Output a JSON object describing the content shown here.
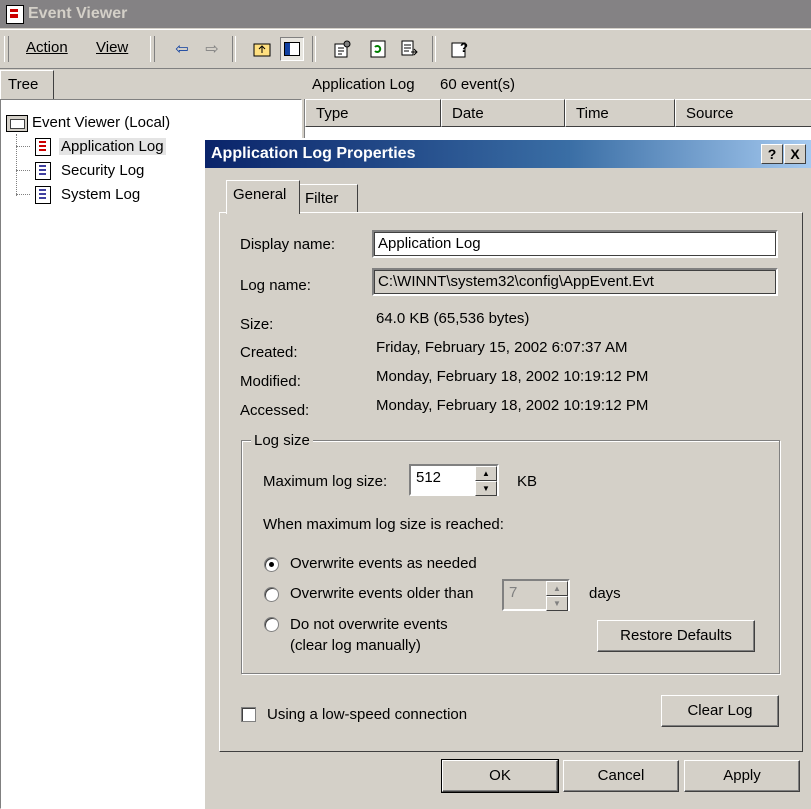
{
  "window": {
    "title": "Event Viewer"
  },
  "menu": {
    "action": "Action",
    "view": "View"
  },
  "toolbar_icons": [
    "back-arrow-icon",
    "forward-arrow-icon",
    "up-folder-icon",
    "show-hide-tree-icon",
    "properties-icon",
    "refresh-icon",
    "export-list-icon",
    "help-icon"
  ],
  "tree": {
    "tab_label": "Tree",
    "root": "Event Viewer (Local)",
    "items": [
      "Application Log",
      "Security Log",
      "System Log"
    ]
  },
  "list": {
    "header_name": "Application Log",
    "header_count": "60 event(s)",
    "columns": [
      "Type",
      "Date",
      "Time",
      "Source"
    ]
  },
  "dialog": {
    "title": "Application Log Properties",
    "tabs": [
      "General",
      "Filter"
    ],
    "display_name_label": "Display name:",
    "display_name_value": "Application Log",
    "log_name_label": "Log name:",
    "log_name_value": "C:\\WINNT\\system32\\config\\AppEvent.Evt",
    "size_label": "Size:",
    "size_value": "64.0 KB (65,536 bytes)",
    "created_label": "Created:",
    "created_value": "Friday, February 15, 2002 6:07:37 AM",
    "modified_label": "Modified:",
    "modified_value": "Monday, February 18, 2002 10:19:12 PM",
    "accessed_label": "Accessed:",
    "accessed_value": "Monday, February 18, 2002 10:19:12 PM",
    "log_size": {
      "group_title": "Log size",
      "max_label": "Maximum log size:",
      "max_value": "512",
      "max_unit": "KB",
      "when_reached_label": "When maximum log size is reached:",
      "options": [
        "Overwrite events as needed",
        "Overwrite events older than",
        "Do not overwrite events",
        "(clear log manually)"
      ],
      "selected_option": "Overwrite events as needed",
      "days_value": "7",
      "days_unit": "days",
      "restore_defaults": "Restore Defaults"
    },
    "low_speed_label": "Using a low-speed connection",
    "low_speed_checked": false,
    "clear_log": "Clear Log",
    "ok": "OK",
    "cancel": "Cancel",
    "apply": "Apply",
    "help_caption": "?",
    "close_caption": "X"
  }
}
